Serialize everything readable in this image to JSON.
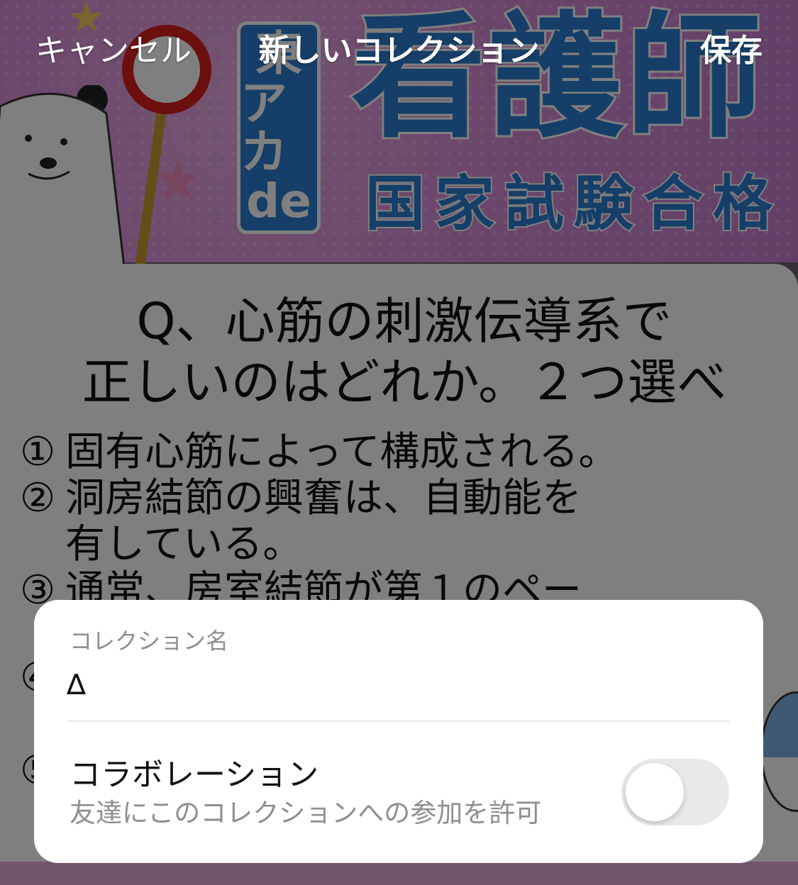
{
  "nav": {
    "cancel_label": "キャンセル",
    "title": "新しいコレクション",
    "save_label": "保存"
  },
  "background_post": {
    "banner": {
      "vertical_label_lines": [
        "東",
        "アカ",
        "de"
      ],
      "title": "看護師",
      "subtitle": "国家試験合格"
    },
    "question": {
      "line1": "Q、心筋の刺激伝導系で",
      "line2": "正しいのはどれか。２つ選べ"
    },
    "options": [
      {
        "num": "①",
        "text": "固有心筋によって構成される。"
      },
      {
        "num": "②",
        "text": "洞房結節の興奮は、自動能を"
      },
      {
        "num": "",
        "text": "有している。"
      },
      {
        "num": "③",
        "text": "通常、房室結節が第１のペー"
      }
    ],
    "partial_option_numbers": [
      "④",
      "⑤"
    ]
  },
  "sheet": {
    "name_label": "コレクション名",
    "name_value": "∆",
    "collab_title": "コラボレーション",
    "collab_subtitle": "友達にこのコレクションへの参加を許可",
    "collab_enabled": false
  },
  "colors": {
    "accent_blue": "#2a7fd0",
    "banner_pink": "#d88ad6",
    "toggle_off": "#e9e9eb",
    "secondary_text": "#8e8e93"
  }
}
